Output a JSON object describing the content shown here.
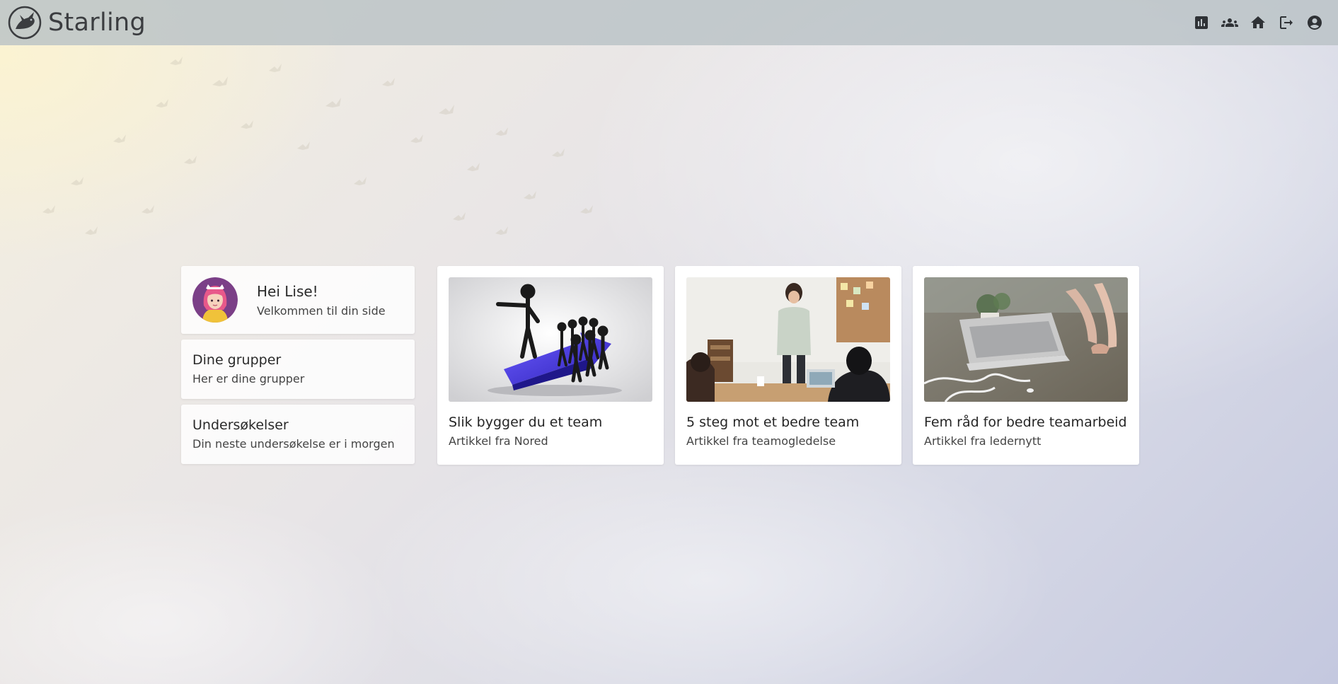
{
  "app": {
    "name": "Starling",
    "logo_icon": "starling-bird-logo"
  },
  "nav": [
    {
      "icon": "bar-chart-icon",
      "label": "Statistics"
    },
    {
      "icon": "groups-icon",
      "label": "Groups"
    },
    {
      "icon": "home-icon",
      "label": "Home"
    },
    {
      "icon": "logout-icon",
      "label": "Log out"
    },
    {
      "icon": "account-icon",
      "label": "Account"
    }
  ],
  "welcome": {
    "title": "Hei Lise!",
    "subtitle": "Velkommen til din side",
    "avatar_icon": "user-avatar"
  },
  "menu": [
    {
      "title": "Dine grupper",
      "subtitle": "Her er dine grupper"
    },
    {
      "title": "Undersøkelser",
      "subtitle": "Din neste undersøkelse er i morgen"
    }
  ],
  "articles": [
    {
      "title": "Slik bygger du et team",
      "source": "Artikkel fra Nored",
      "image_icon": "team-leader-arrow-illustration"
    },
    {
      "title": "5 steg mot et bedre team",
      "source": "Artikkel fra teamogledelse",
      "image_icon": "office-meeting-photo"
    },
    {
      "title": "Fem råd for bedre teamarbeid",
      "source": "Artikkel fra ledernytt",
      "image_icon": "laptop-desk-photo"
    }
  ],
  "colors": {
    "topbar": "#bac2c6",
    "card": "#ffffff",
    "accent_purple": "#6a3d8f"
  }
}
